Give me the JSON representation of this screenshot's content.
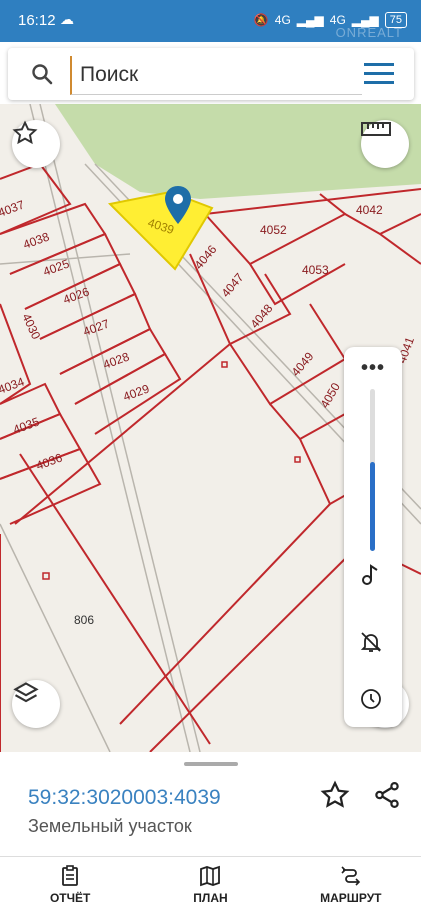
{
  "status_bar": {
    "time": "16:12",
    "network_label": "4G",
    "network_label_2": "4G",
    "battery": "75",
    "watermark": "ONREALT"
  },
  "search": {
    "placeholder": "Поиск",
    "value": ""
  },
  "map": {
    "parcel_labels": [
      "4037",
      "4038",
      "4025",
      "4026",
      "4027",
      "4028",
      "4029",
      "4030",
      "4034",
      "4035",
      "4036",
      "4039",
      "4046",
      "4047",
      "4048",
      "4052",
      "4053",
      "4042",
      "4049",
      "4050",
      "4041"
    ],
    "selected_parcel": "4039",
    "road_label": "806",
    "colors": {
      "parcel_border": "#c0282c",
      "selected_fill": "#ffee33",
      "forest": "#c5dcaa",
      "ground": "#f2efe9",
      "pin": "#1e6ea8"
    }
  },
  "zoom_panel": {
    "more_label": "•••",
    "zoom_level": 0.55
  },
  "selected_object": {
    "cadastral_number": "59:32:3020003:4039",
    "type": "Земельный участок"
  },
  "bottom_nav": [
    {
      "label": "ОТЧЁТ",
      "icon": "report-icon"
    },
    {
      "label": "ПЛАН",
      "icon": "map-plan-icon"
    },
    {
      "label": "МАРШРУТ",
      "icon": "route-icon"
    }
  ]
}
